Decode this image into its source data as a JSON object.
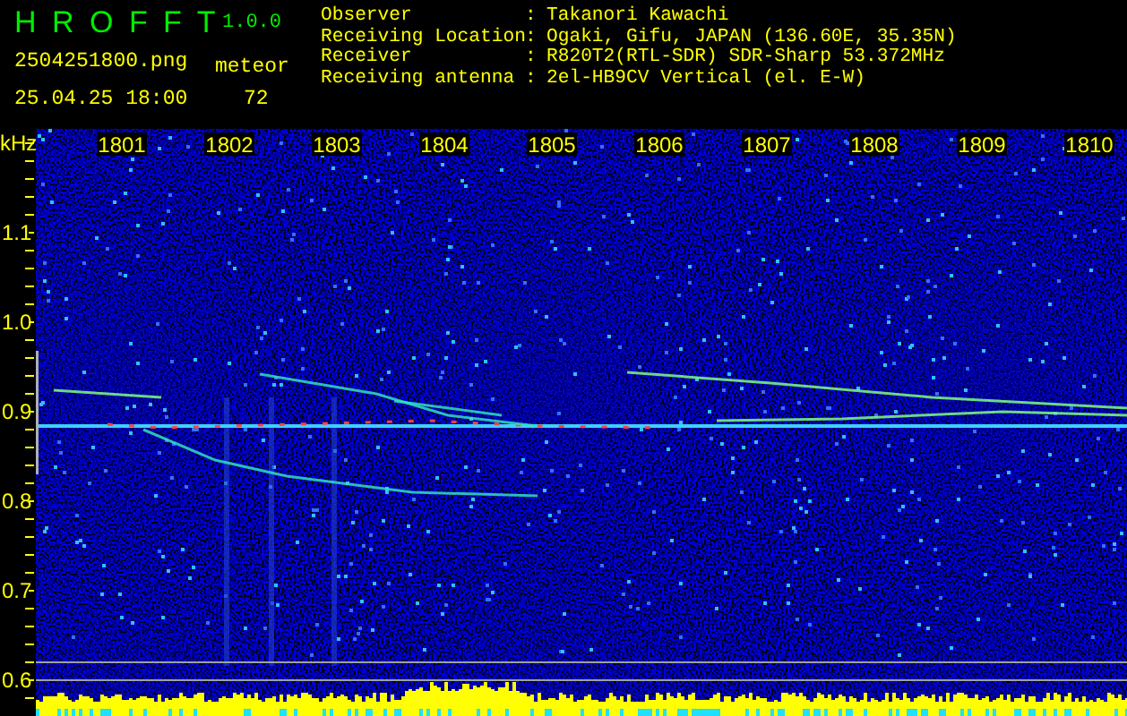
{
  "app": {
    "title": "H R O F F T",
    "version": "1.0.0"
  },
  "file_name": "2504251800.png",
  "date_time": "25.04.25 18:00",
  "meteor": {
    "label": "meteor",
    "count": "72"
  },
  "info_rows": [
    {
      "label": "Observer",
      "separator": ":",
      "value": "Takanori Kawachi"
    },
    {
      "label": "Receiving Location",
      "separator": ":",
      "value": "Ogaki, Gifu, JAPAN (136.60E, 35.35N)"
    },
    {
      "label": "Receiver",
      "separator": ":",
      "value": "R820T2(RTL-SDR) SDR-Sharp 53.372MHz"
    },
    {
      "label": "Receiving antenna",
      "separator": ":",
      "value": "2el-HB9CV Vertical (el. E-W)"
    }
  ],
  "plot": {
    "unit": "kHz",
    "time_labels": [
      "1801",
      "1802",
      "1803",
      "1804",
      "1805",
      "1806",
      "1807",
      "1808",
      "1809",
      "1810"
    ],
    "frequency_labels": [
      "1.1",
      "1.0",
      "0.9",
      "0.8",
      "0.7",
      "0.6"
    ]
  }
}
